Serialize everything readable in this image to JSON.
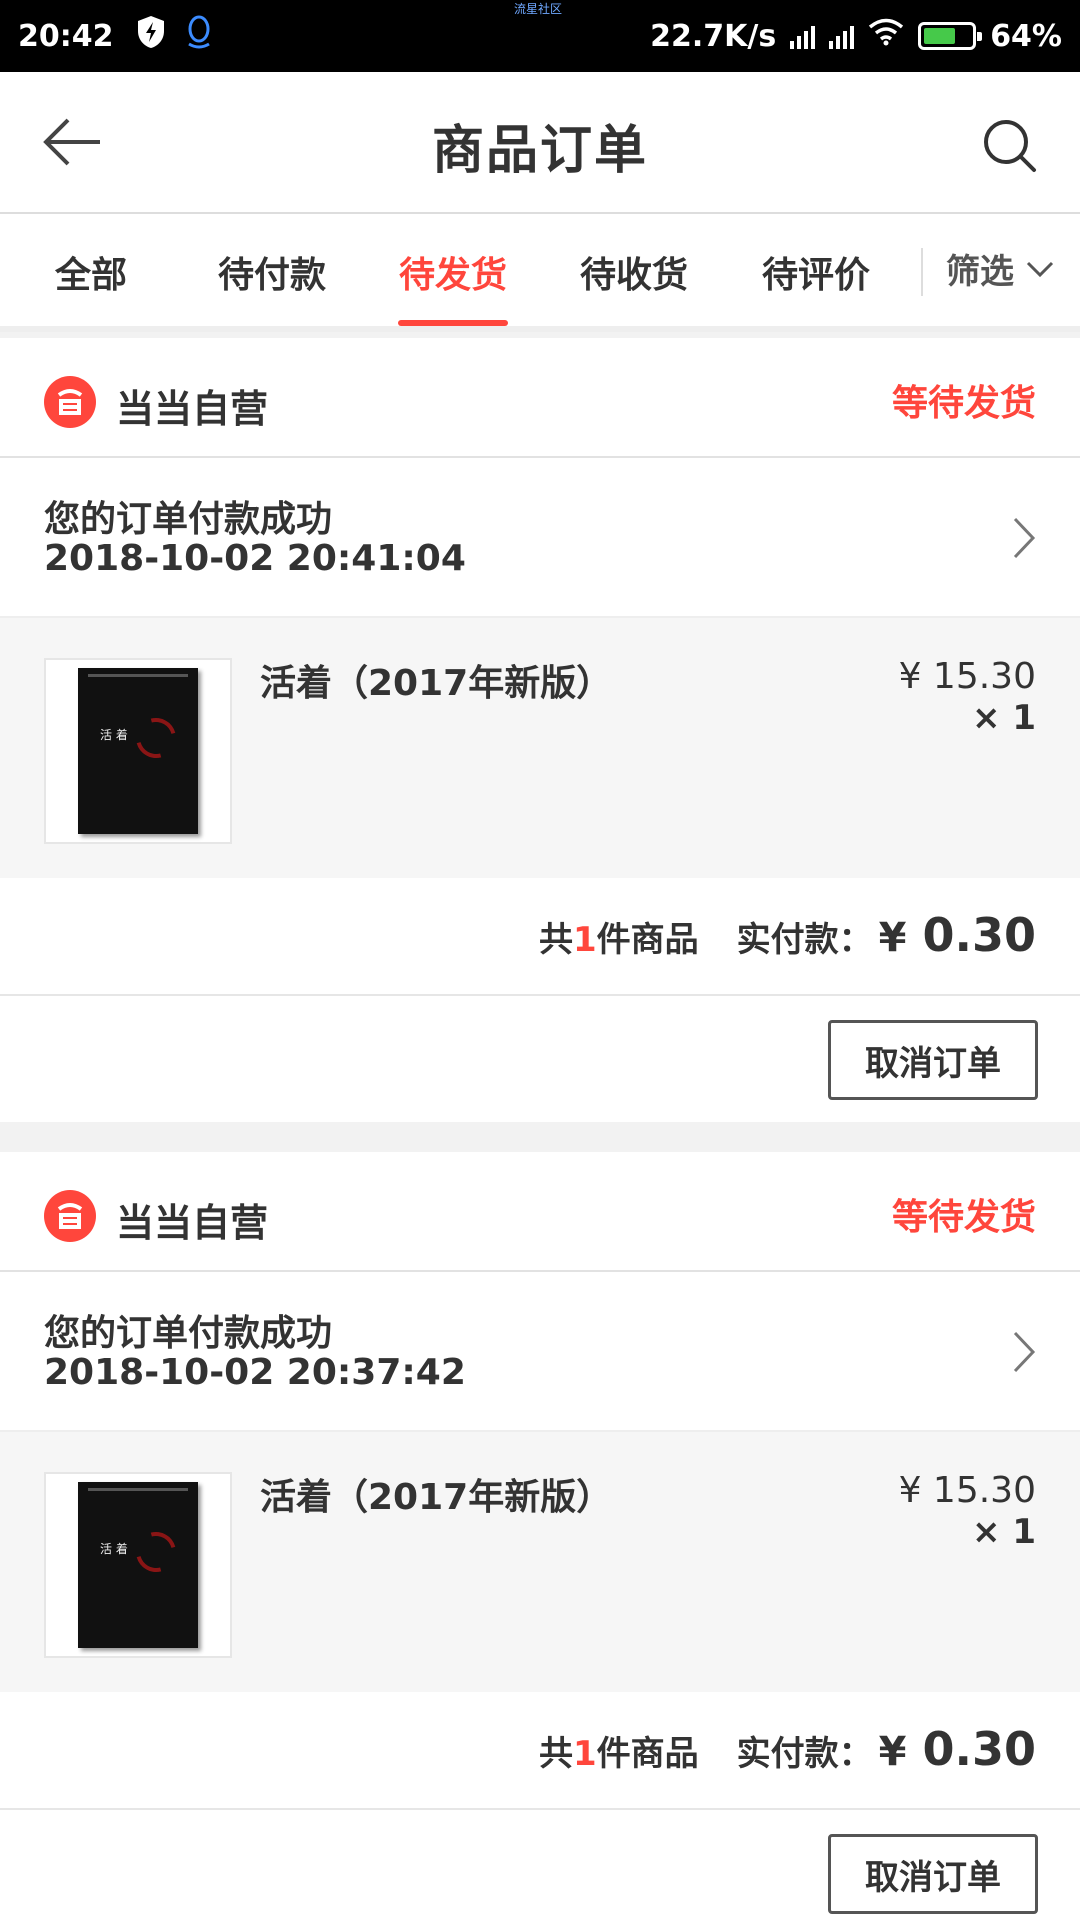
{
  "status_bar": {
    "time": "20:42",
    "carrier_label": "流星社区",
    "network_speed": "22.7K/s",
    "battery": "64%"
  },
  "header": {
    "title": "商品订单"
  },
  "tabs": [
    {
      "label": "全部",
      "active": false
    },
    {
      "label": "待付款",
      "active": false
    },
    {
      "label": "待发货",
      "active": true
    },
    {
      "label": "待收货",
      "active": false
    },
    {
      "label": "待评价",
      "active": false
    }
  ],
  "filter_label": "筛选",
  "orders": [
    {
      "shop_name": "当当自营",
      "status": "等待发货",
      "message": "您的订单付款成功",
      "time": "2018-10-02 20:41:04",
      "item": {
        "title": "活着（2017年新版）",
        "price": "¥ 15.30",
        "qty": "× 1"
      },
      "count_prefix": "共",
      "count_num": "1",
      "count_suffix": "件商品",
      "paid_label": "实付款：",
      "currency": "¥",
      "amount": "0.30",
      "cancel_label": "取消订单"
    },
    {
      "shop_name": "当当自营",
      "status": "等待发货",
      "message": "您的订单付款成功",
      "time": "2018-10-02 20:37:42",
      "item": {
        "title": "活着（2017年新版）",
        "price": "¥ 15.30",
        "qty": "× 1"
      },
      "count_prefix": "共",
      "count_num": "1",
      "count_suffix": "件商品",
      "paid_label": "实付款：",
      "currency": "¥",
      "amount": "0.30",
      "cancel_label": "取消订单"
    }
  ],
  "colors": {
    "accent": "#ff463c",
    "status_bar_bg": "#000000",
    "page_bg": "#f2f2f2"
  }
}
